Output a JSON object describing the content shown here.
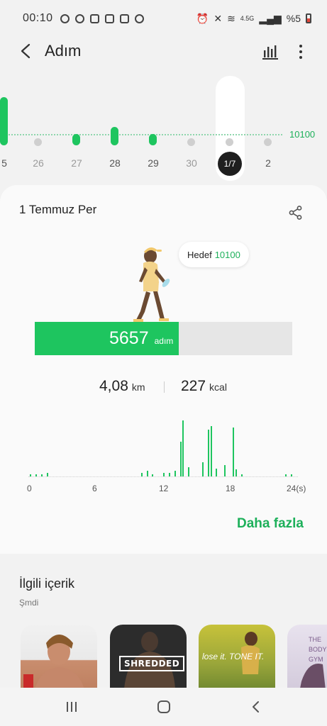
{
  "status_bar": {
    "time": "00:10",
    "network": "4.5G",
    "battery": "%5"
  },
  "app_bar": {
    "title": "Adım"
  },
  "day_strip": {
    "goal_value": "10100",
    "days": [
      {
        "label": "5",
        "bar_fraction": 0.75
      },
      {
        "label": "26",
        "bar_fraction": 0
      },
      {
        "label": "27",
        "bar_fraction": 0.18
      },
      {
        "label": "28",
        "bar_fraction": 0.29
      },
      {
        "label": "29",
        "bar_fraction": 0.18
      },
      {
        "label": "30",
        "bar_fraction": 0
      },
      {
        "label": "1/7",
        "bar_fraction": 0,
        "selected": true
      },
      {
        "label": "2",
        "bar_fraction": 0
      }
    ]
  },
  "card": {
    "date": "1 Temmuz Per",
    "goal_label": "Hedef",
    "goal_value": "10100",
    "steps": "5657",
    "steps_unit": "adım",
    "steps_count": 5657,
    "steps_goal": 10100,
    "distance": "4,08",
    "distance_unit": "km",
    "calories": "227",
    "calories_unit": "kcal",
    "more_label": "Daha fazla"
  },
  "chart_data": {
    "type": "bar",
    "xlabel": "",
    "ylabel": "",
    "x_ticks": [
      "0",
      "6",
      "12",
      "18",
      "24(s)"
    ],
    "xlim": [
      0,
      24
    ],
    "x": [
      0,
      0.5,
      1,
      1.5,
      10,
      10.5,
      11,
      12,
      12.5,
      13,
      13.5,
      13.75,
      14.25,
      15.5,
      16,
      16.25,
      16.75,
      17.5,
      18.25,
      18.5,
      19,
      23,
      23.5
    ],
    "values": [
      2,
      2,
      2,
      3,
      3,
      5,
      2,
      3,
      3,
      5,
      30,
      48,
      8,
      12,
      40,
      43,
      7,
      10,
      42,
      6,
      2,
      2,
      2
    ],
    "grid": false
  },
  "related": {
    "title": "İlgili içerik",
    "subtitle": "Şmdi",
    "items": [
      {
        "label": ""
      },
      {
        "label": "SHREDDED"
      },
      {
        "label": "lose it. TONE IT."
      },
      {
        "label": "THE BODY GYM"
      }
    ]
  },
  "colors": {
    "accent": "#1ec55f",
    "accent_text": "#1db05a",
    "selected_day": "#1f1f1f"
  },
  "icons": [
    "back-icon",
    "bar-chart-icon",
    "more-vert-icon",
    "share-icon",
    "recents-icon",
    "home-icon",
    "nav-back-icon"
  ]
}
